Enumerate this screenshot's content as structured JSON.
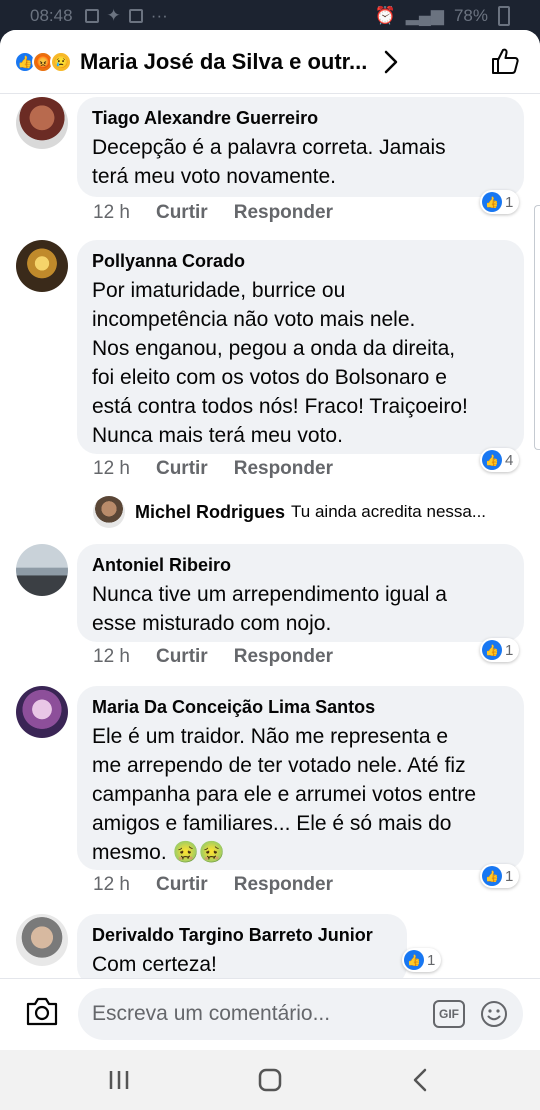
{
  "status_bar": {
    "time": "08:48",
    "battery": "78%"
  },
  "header": {
    "title": "Maria José da Silva e outr..."
  },
  "comments": [
    {
      "author": "Tiago Alexandre Guerreiro",
      "lines": [
        "Decepção é a palavra correta. Jamais",
        "terá meu voto novamente."
      ],
      "time": "12 h",
      "like_label": "Curtir",
      "reply_label": "Responder",
      "likes": "1"
    },
    {
      "author": "Pollyanna Corado",
      "lines": [
        "Por imaturidade, burrice ou",
        "incompetência não voto mais nele.",
        "Nos enganou, pegou a onda da direita,",
        "foi eleito com os votos do Bolsonaro e",
        "está contra todos nós! Fraco! Traiçoeiro!",
        "Nunca mais terá meu voto."
      ],
      "time": "12 h",
      "like_label": "Curtir",
      "reply_label": "Responder",
      "likes": "4",
      "reply": {
        "author": "Michel Rodrigues",
        "text": "Tu ainda acredita nessa..."
      }
    },
    {
      "author": "Antoniel Ribeiro",
      "lines": [
        "Nunca tive um arrependimento igual a",
        "esse misturado com nojo."
      ],
      "time": "12 h",
      "like_label": "Curtir",
      "reply_label": "Responder",
      "likes": "1"
    },
    {
      "author": "Maria Da Conceição Lima Santos",
      "lines": [
        "Ele é um traidor. Não me representa e",
        "me arrependo de ter votado nele. Até fiz",
        "campanha para ele e arrumei votos entre",
        "amigos e familiares... Ele é só mais do",
        "mesmo. 🤢🤢"
      ],
      "time": "12 h",
      "like_label": "Curtir",
      "reply_label": "Responder",
      "likes": "1"
    },
    {
      "author": "Derivaldo Targino Barreto Junior",
      "lines": [
        "Com certeza!"
      ],
      "likes": "1"
    }
  ],
  "composer": {
    "placeholder": "Escreva um comentário...",
    "gif_label": "GIF"
  },
  "icons": {
    "like_reaction": "thumbs-up-icon",
    "angry_reaction": "angry-face-icon",
    "sad_reaction": "sad-face-icon",
    "camera": "camera-icon",
    "emoji": "smiley-icon",
    "nav_recents": "recents-icon",
    "nav_home": "home-icon",
    "nav_back": "back-icon"
  },
  "colors": {
    "accent": "#1877f2",
    "bubble": "#f0f2f5",
    "secondary_text": "#65676b"
  }
}
